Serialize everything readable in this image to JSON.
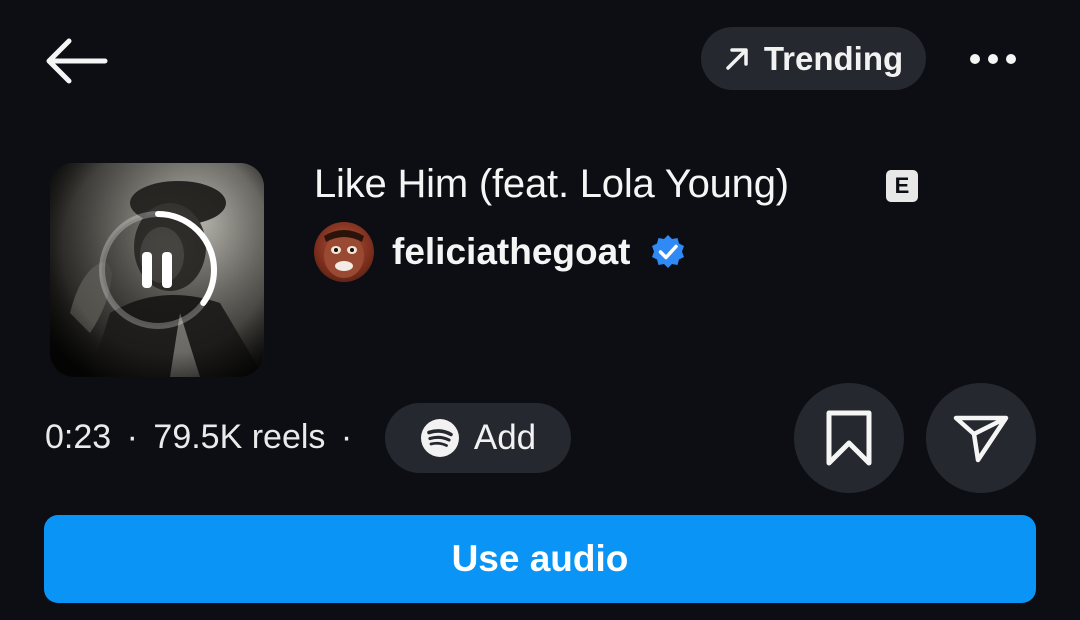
{
  "header": {
    "back_icon": "arrow-left-icon",
    "trending_label": "Trending",
    "trending_icon": "arrow-up-right-icon",
    "more_icon": "more-horizontal-icon"
  },
  "track": {
    "title": "Like Him (feat. Lola Young)",
    "explicit_badge": "E",
    "artist": "feliciathegoat",
    "verified_icon": "verified-badge-icon",
    "play_state_icon": "pause-icon",
    "playback_progress": 0.35
  },
  "meta": {
    "duration": "0:23",
    "reels_count": "79.5K reels",
    "separator": "·",
    "add_label": "Add",
    "add_icon": "spotify-icon"
  },
  "actions": {
    "save_icon": "bookmark-icon",
    "share_icon": "send-icon",
    "use_audio_label": "Use audio"
  },
  "colors": {
    "background": "#0c0e13",
    "pill": "#25282e",
    "accent": "#0a95f6",
    "verified": "#2f8af5"
  }
}
